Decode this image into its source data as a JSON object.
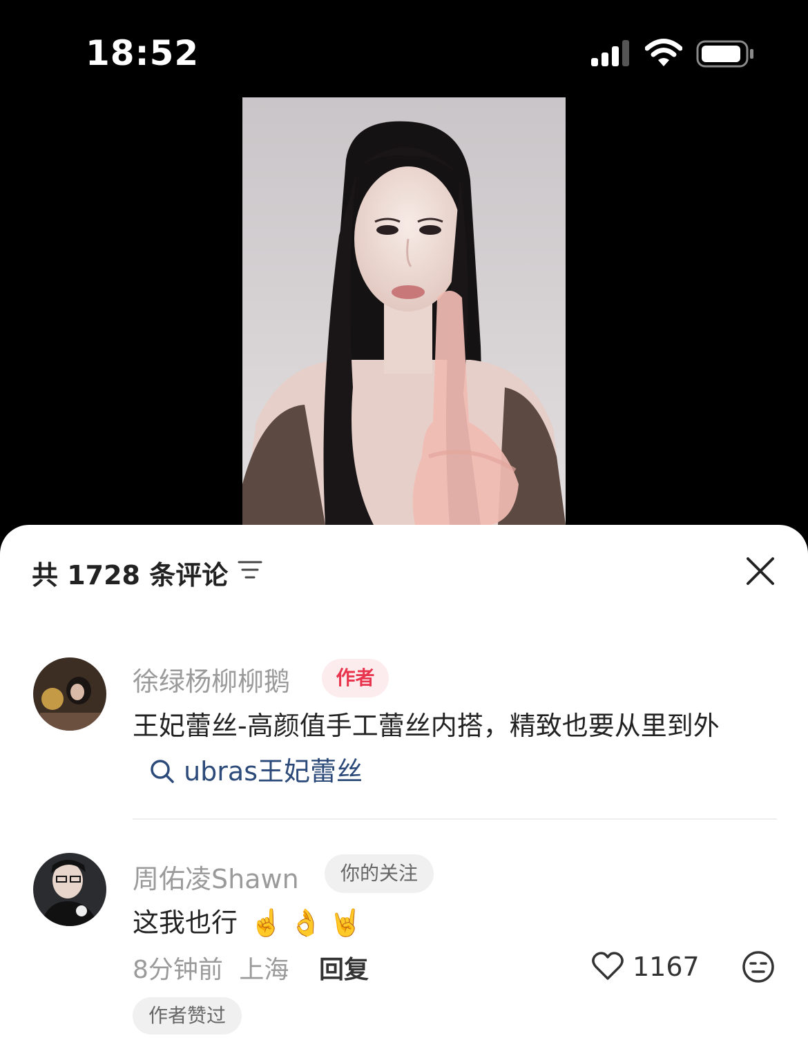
{
  "status_bar": {
    "time": "18:52"
  },
  "comments": {
    "header": "共 1728 条评论",
    "items": [
      {
        "username": "徐绿杨柳柳鹅",
        "tag": "作者",
        "text": "王妃蕾丝-高颜值手工蕾丝内搭，精致也要从里到外",
        "search_link": "ubras王妃蕾丝"
      },
      {
        "username": "周佑凌Shawn",
        "tag": "你的关注",
        "text": "这我也行",
        "emojis": "☝️👌🤘",
        "time": "8分钟前",
        "location": "上海",
        "reply_label": "回复",
        "like_count": "1167",
        "badge": "作者赞过"
      }
    ]
  },
  "colors": {
    "author_tag": "#e8344c",
    "link": "#2b4a7a",
    "muted": "#9a9a9a"
  }
}
